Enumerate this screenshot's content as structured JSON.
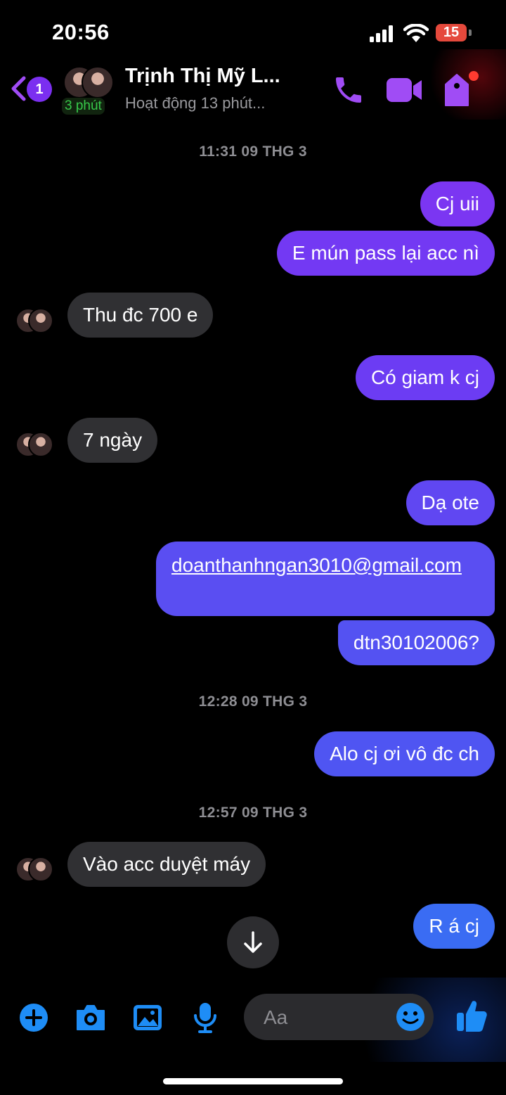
{
  "status_bar": {
    "time": "20:56",
    "battery": "15"
  },
  "header": {
    "back_badge": "1",
    "active_pill": "3 phút",
    "contact_name": "Trịnh Thị Mỹ L...",
    "contact_status": "Hoạt động 13 phút..."
  },
  "messages": {
    "ts1": "11:31 09 THG 3",
    "m1": "Cj uii",
    "m2": "E mún pass lại acc nì",
    "m3": "Thu đc 700 e",
    "m4": "Có giam k cj",
    "m5": "7 ngày",
    "m6": "Dạ ote",
    "m7": "doanthanhngan3010@gmail.com",
    "m8": "dtn30102006?",
    "ts2": "12:28 09 THG 3",
    "m9": "Alo cj ơi vô đc ch",
    "ts3": "12:57 09 THG 3",
    "m10": "Vào acc duyệt máy",
    "m11": "R á cj"
  },
  "composer": {
    "placeholder": "Aa"
  },
  "colors": {
    "purple": "#7b36f2",
    "violet": "#6c3cf3",
    "indigo": "#5a4ef2",
    "blue_violet": "#4f55f2",
    "blue": "#3a6cf3",
    "incoming": "#303033",
    "accent_header": "#a04cf5",
    "accent_bottom": "#1e8df6"
  }
}
